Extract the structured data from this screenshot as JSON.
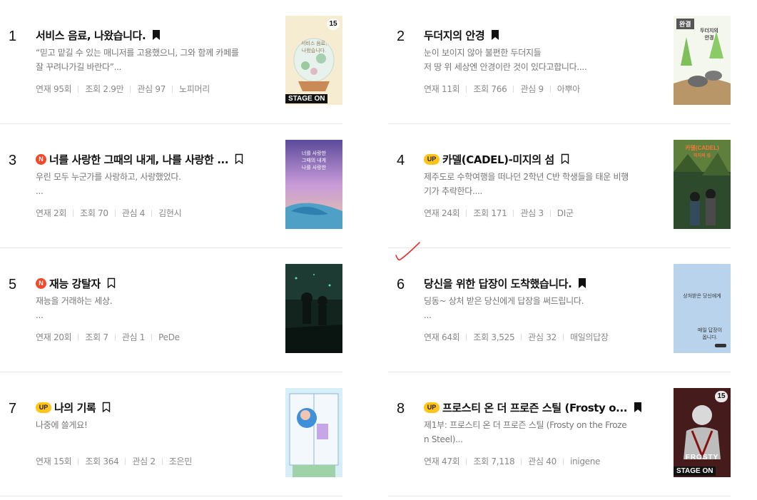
{
  "labels": {
    "serial": "연재",
    "views": "조회",
    "interest": "관심",
    "stage_on": "STAGE ON",
    "completed": "완결",
    "badge_new": "N",
    "badge_up": "UP"
  },
  "items": [
    {
      "rank": "1",
      "title": "서비스 음료, 나왔습니다.",
      "badge": "",
      "bookmarked": true,
      "desc": [
        "“믿고 맡길 수 있는 매니저를 고용했으니, 그와 함께 카페를",
        "잘 꾸려나가길 바란다”..."
      ],
      "episodes": "95회",
      "views": "2.9만",
      "interest": "97",
      "author": "노피머리",
      "thumb_count": "15",
      "thumb_text": [
        "서비스 음료,",
        "나왔습니다."
      ],
      "stage_on": true,
      "completed": false
    },
    {
      "rank": "2",
      "title": "두더지의 안경",
      "badge": "",
      "bookmarked": true,
      "desc": [
        "눈이 보이지 않아 불편한 두더지들",
        "저 땅 위 세상엔 안경이란 것이 있다고합니다...."
      ],
      "episodes": "11회",
      "views": "766",
      "interest": "9",
      "author": "아뿌아",
      "thumb_count": "",
      "thumb_text": [
        "두더지의",
        "안경"
      ],
      "stage_on": false,
      "completed": true
    },
    {
      "rank": "3",
      "title": "너를 사랑한 그때의 내게, 나를 사랑한 ...",
      "badge": "N",
      "bookmarked": false,
      "desc": [
        "우린 모두 누군가를 사랑하고, 사랑했었다.",
        "..."
      ],
      "episodes": "2회",
      "views": "70",
      "interest": "4",
      "author": "김현시",
      "thumb_count": "",
      "thumb_text": [
        "너를 사랑한",
        "그때의 내게",
        "나를 사랑한"
      ],
      "stage_on": false,
      "completed": false
    },
    {
      "rank": "4",
      "title": "카델(CADEL)-미지의 섬",
      "badge": "UP",
      "bookmarked": false,
      "desc": [
        "제주도로 수학여행을 떠나던 2학년 C반 학생들을 태운 비행",
        "기가 추락한다...."
      ],
      "episodes": "24회",
      "views": "171",
      "interest": "3",
      "author": "DI군",
      "thumb_count": "",
      "thumb_text": [
        "카델(CADEL)",
        "미지의 섬"
      ],
      "stage_on": false,
      "completed": false
    },
    {
      "rank": "5",
      "title": "재능 강탈자",
      "badge": "N",
      "bookmarked": false,
      "desc": [
        "재능을 거래하는 세상.",
        "..."
      ],
      "episodes": "20회",
      "views": "7",
      "interest": "1",
      "author": "PeDe",
      "thumb_count": "",
      "thumb_text": [],
      "stage_on": false,
      "completed": false
    },
    {
      "rank": "6",
      "title": "당신을 위한 답장이 도착했습니다.",
      "badge": "",
      "bookmarked": true,
      "desc": [
        "딩동~ 상처 받은 당신에게 답장을 써드립니다.",
        "..."
      ],
      "episodes": "64회",
      "views": "3,525",
      "interest": "32",
      "author": "매일의답장",
      "thumb_count": "",
      "thumb_text": [
        "상처받은 당신에게",
        "매일 답장이",
        "옵니다."
      ],
      "stage_on": false,
      "completed": false
    },
    {
      "rank": "7",
      "title": "나의 기록",
      "badge": "UP",
      "bookmarked": false,
      "desc": [
        "나중에 쓸게요!",
        ""
      ],
      "episodes": "15회",
      "views": "364",
      "interest": "2",
      "author": "조은민",
      "thumb_count": "",
      "thumb_text": [],
      "stage_on": false,
      "completed": false
    },
    {
      "rank": "8",
      "title": "프로스티 온 더 프로즌 스틸 (Frosty o...",
      "badge": "UP",
      "bookmarked": true,
      "desc": [
        "제1부: 프로스티 온 더 프로즌 스틸 (Frosty on the Froze",
        "n Steel)..."
      ],
      "episodes": "47회",
      "views": "7,118",
      "interest": "40",
      "author": "inigene",
      "thumb_count": "15",
      "thumb_text": [
        "FROSTY"
      ],
      "stage_on": true,
      "completed": false
    }
  ],
  "colors": {
    "new_badge": "#f2492b",
    "up_badge": "#ffc417",
    "title": "#111111",
    "desc": "#777777",
    "meta": "#888888",
    "divider": "#e6e6e6",
    "pen_mark": "#e4312b"
  }
}
